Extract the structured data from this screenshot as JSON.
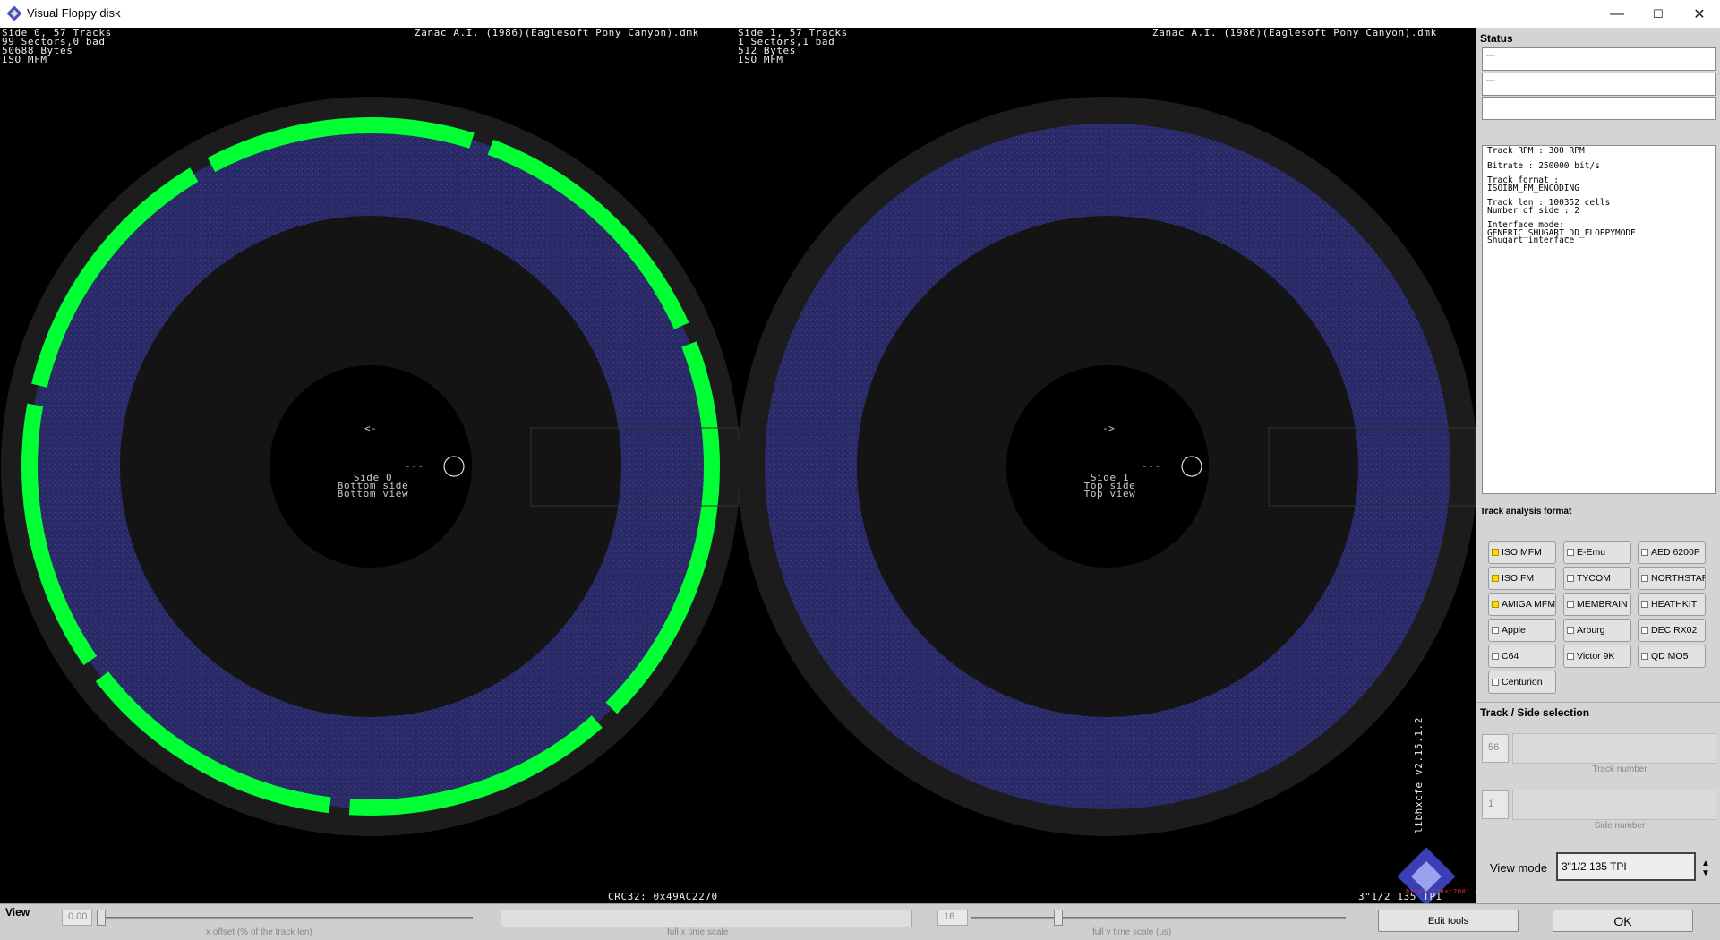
{
  "window": {
    "title": "Visual Floppy disk",
    "controls": [
      "—",
      "☐",
      "✕"
    ]
  },
  "left_disk": {
    "header_lines": [
      "Side 0, 57 Tracks",
      "99 Sectors,0 bad",
      "50688 Bytes",
      "ISO MFM"
    ],
    "filename": "Zanac A.I. (1986)(Eaglesoft Pony Canyon).dmk",
    "arrow": "<-",
    "dash": "---",
    "center_lines": [
      "Side 0",
      "Bottom side",
      "Bottom view"
    ]
  },
  "right_disk": {
    "header_lines": [
      "Side 1, 57 Tracks",
      "1 Sectors,1 bad",
      "512 Bytes",
      "ISO MFM"
    ],
    "filename": "Zanac A.I. (1986)(Eaglesoft Pony Canyon).dmk",
    "arrow": "->",
    "dash": "---",
    "center_lines": [
      "Side 1",
      "Top side",
      "Top view"
    ]
  },
  "footer": {
    "crc": "CRC32: 0x49AC2270",
    "format": "3\"1/2 135 TPI",
    "version": "libhxcfe v2.15.1.2",
    "url": "https://hxc2001.com"
  },
  "status": {
    "title": "Status",
    "field1": "---",
    "field2": "---",
    "field3": "",
    "info_lines": [
      "Track RPM : 300 RPM",
      "",
      "Bitrate : 250000 bit/s",
      "",
      "Track format :",
      "ISOIBM_FM_ENCODING",
      "",
      "Track len : 100352 cells",
      "Number of side : 2",
      "",
      "Interface mode:",
      "GENERIC_SHUGART_DD_FLOPPYMODE",
      "Shugart interface"
    ]
  },
  "track_analysis": {
    "title": "Track analysis format",
    "buttons": [
      {
        "label": "ISO MFM",
        "checked": true
      },
      {
        "label": "E-Emu",
        "checked": false
      },
      {
        "label": "AED 6200P",
        "checked": false
      },
      {
        "label": "ISO FM",
        "checked": true
      },
      {
        "label": "TYCOM",
        "checked": false
      },
      {
        "label": "NORTHSTAR",
        "checked": false
      },
      {
        "label": "AMIGA MFM",
        "checked": true
      },
      {
        "label": "MEMBRAIN",
        "checked": false
      },
      {
        "label": "HEATHKIT",
        "checked": false
      },
      {
        "label": "Apple",
        "checked": false
      },
      {
        "label": "Arburg",
        "checked": false
      },
      {
        "label": "DEC RX02",
        "checked": false
      },
      {
        "label": "C64",
        "checked": false
      },
      {
        "label": "Victor 9K",
        "checked": false
      },
      {
        "label": "QD MO5",
        "checked": false
      },
      {
        "label": "Centurion",
        "checked": false
      }
    ]
  },
  "track_side": {
    "title": "Track / Side selection",
    "track_value": "56",
    "track_label": "Track number",
    "side_value": "1",
    "side_label": "Side number",
    "view_mode_label": "View mode",
    "view_mode_value": "3\"1/2 135 TPI"
  },
  "bottom": {
    "view_label": "View",
    "xoffset_value": "0.00",
    "xoffset_caption": "x offset (% of the track len)",
    "full_x_caption": "full x time scale",
    "scale_value": "16",
    "full_time_caption": "full y time scale (us)",
    "edit_tools": "Edit tools",
    "ok": "OK"
  },
  "colors": {
    "disk_surface": "#2a2a66",
    "sector_good": "#00ff33",
    "sector_gap": "#99ff99",
    "outer_ring": "#1c1c1c"
  }
}
